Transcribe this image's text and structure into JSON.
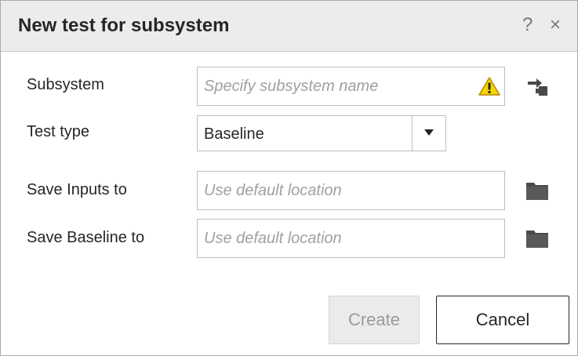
{
  "dialog": {
    "title": "New test for subsystem",
    "help_label": "?",
    "close_label": "×"
  },
  "form": {
    "subsystem": {
      "label": "Subsystem",
      "value": "",
      "placeholder": "Specify subsystem name",
      "status_icon": "warning-icon",
      "action_icon": "select-subsystem-icon"
    },
    "test_type": {
      "label": "Test type",
      "value": "Baseline",
      "dropdown_icon": "chevron-down-icon"
    },
    "save_inputs": {
      "label": "Save Inputs to",
      "value": "",
      "placeholder": "Use default location",
      "action_icon": "folder-icon"
    },
    "save_baseline": {
      "label": "Save Baseline to",
      "value": "",
      "placeholder": "Use default location",
      "action_icon": "folder-icon"
    }
  },
  "buttons": {
    "create_label": "Create",
    "create_enabled": false,
    "cancel_label": "Cancel"
  },
  "colors": {
    "titlebar_bg": "#ececec",
    "warning_yellow": "#f5d400",
    "icon_dark": "#555555",
    "disabled_text": "#9a9a9a"
  }
}
